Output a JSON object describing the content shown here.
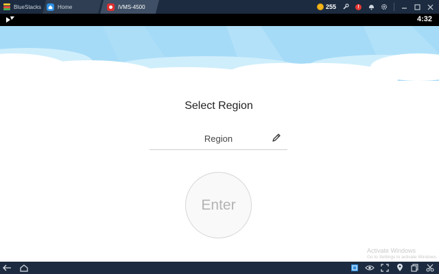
{
  "titlebar": {
    "app_name": "BlueStacks",
    "tabs": [
      {
        "label": "Home",
        "icon": "home-icon"
      },
      {
        "label": "iVMS-4500",
        "icon": "ivms-app-icon"
      }
    ],
    "coins": "255",
    "notification_count": "!",
    "icons": [
      "coin-icon",
      "wrench-icon",
      "alert-icon",
      "bell-icon",
      "gear-icon",
      "minimize-icon",
      "maximize-icon",
      "close-icon"
    ]
  },
  "statusbar": {
    "time": "4:32"
  },
  "screen": {
    "title": "Select Region",
    "region_field": {
      "value": "Region"
    },
    "enter_label": "Enter"
  },
  "watermark": {
    "line1": "Activate Windows",
    "line2": "Go to Settings to activate Windows."
  },
  "bottombar": {
    "icons": [
      "back-icon",
      "home-icon",
      "keyboard-icon",
      "eye-icon",
      "resize-icon",
      "location-icon",
      "copy-icon",
      "scissors-icon"
    ]
  },
  "colors": {
    "chrome": "#1c2b3f",
    "sky": "#a6dbf7",
    "cloud": "#ffffff"
  }
}
